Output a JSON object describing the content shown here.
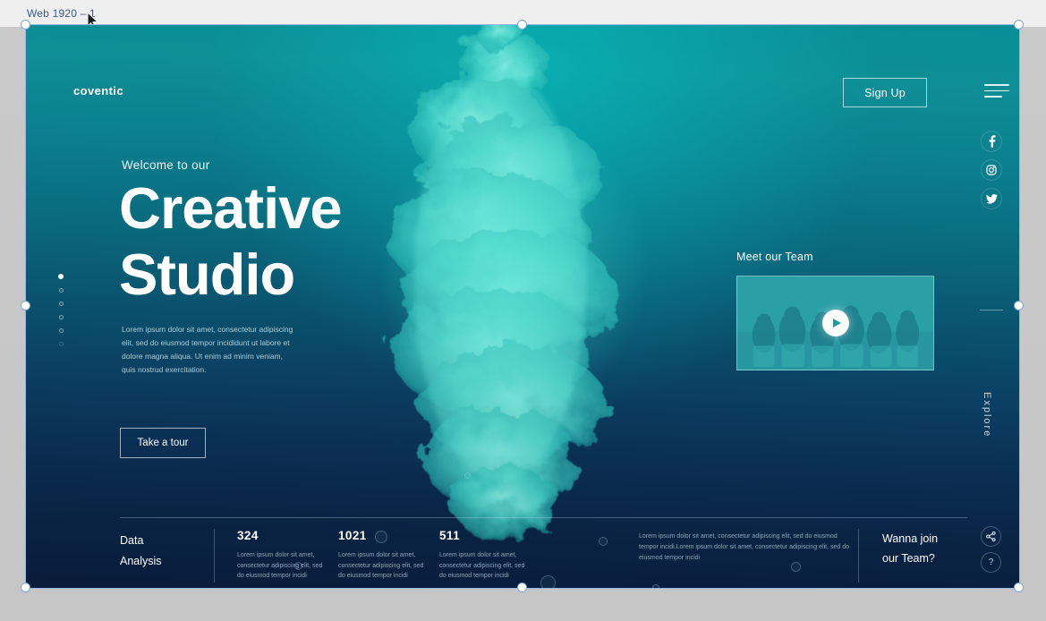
{
  "tool": {
    "artboard_label": "Web 1920 – 1",
    "cursor_icon": "mouse-pointer-icon",
    "canvas_bg": "#c6c6c6",
    "toolbar_bg": "#efefef",
    "selection_color": "#93b7e0"
  },
  "header": {
    "brand": "coventic",
    "signup_label": "Sign Up",
    "menu_icon": "hamburger-menu-icon"
  },
  "hero": {
    "eyebrow": "Welcome to our",
    "title_line1": "Creative",
    "title_line2": "Studio",
    "paragraph": "Lorem ipsum dolor sit amet, consectetur adipiscing elit, sed do eiusmod tempor incididunt ut labore et dolore magna aliqua. Ut enim ad minim veniam, quis nostrud exercitation.",
    "cta_label": "Take a tour"
  },
  "dot_nav": {
    "icon": "slide-dots-icon",
    "dots": [
      {
        "state": "active"
      },
      {
        "state": "inactive"
      },
      {
        "state": "inactive"
      },
      {
        "state": "inactive"
      },
      {
        "state": "inactive"
      },
      {
        "state": "faint"
      }
    ]
  },
  "team": {
    "title": "Meet our Team",
    "play_icon": "play-button-icon",
    "thumbnail_alt": "team-group-photo"
  },
  "right_rail": {
    "social": [
      {
        "name": "facebook",
        "icon": "facebook-icon",
        "glyph": "f"
      },
      {
        "name": "instagram",
        "icon": "instagram-icon",
        "glyph": "▢"
      },
      {
        "name": "twitter",
        "icon": "twitter-icon",
        "glyph": "ᵥ"
      }
    ],
    "explore_label": "Explore",
    "share_icon": "share-icon",
    "help_icon": "question-mark-icon",
    "help_glyph": "?"
  },
  "footer": {
    "heading_line1": "Data",
    "heading_line2": "Analysis",
    "stats": [
      {
        "value": "324",
        "description": "Lorem ipsum dolor sit amet, consectetur adipiscing elit, sed do eiusmod tempor incidi"
      },
      {
        "value": "1021",
        "description": "Lorem ipsum dolor sit amet, consectetur adipiscing elit, sed do eiusmod tempor incidi"
      },
      {
        "value": "511",
        "description": "Lorem ipsum dolor sit amet, consectetur adipiscing elit, sed do eiusmod tempor incidi"
      }
    ],
    "note": "Lorem ipsum dolor sit amet, consectetur adipiscing elit, sed do eiusmod tempor incidi.Lorem ipsum dolor sit amet, consectetur adipiscing elit, sed do eiusmod tempor incidi",
    "cta_line1": "Wanna join",
    "cta_line2": "our Team?"
  },
  "colors": {
    "teal_top": "#0a8d96",
    "navy_bottom": "#091c39",
    "ink_cyan": "#5deadd",
    "accent_white": "#ffffff"
  }
}
